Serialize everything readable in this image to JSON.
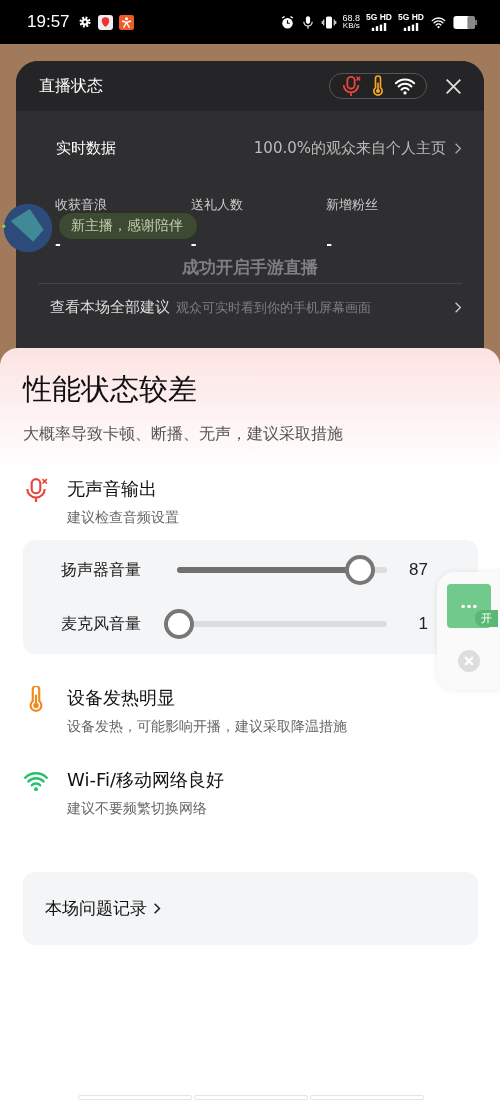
{
  "status_bar": {
    "time": "19:57",
    "speed": "68.8",
    "speed_unit": "KB/s",
    "networks": [
      "5G HD",
      "5G HD"
    ]
  },
  "live_panel": {
    "title": "直播状态",
    "realtime": {
      "label": "实时数据",
      "summary": "100.0%的观众来自个人主页"
    },
    "stats": [
      {
        "label": "收获音浪",
        "value": "-"
      },
      {
        "label": "送礼人数",
        "value": "-"
      },
      {
        "label": "新增粉丝",
        "value": "-"
      }
    ],
    "toast": {
      "title": "成功开启手游直播",
      "message": "观众可实时看到你的手机屏幕画面"
    },
    "suggestions_link": "查看本场全部建议"
  },
  "badge": {
    "text": "新主播，感谢陪伴"
  },
  "sheet": {
    "title": "性能状态较差",
    "subtitle": "大概率导致卡顿、断播、无声，建议采取措施",
    "issues": [
      {
        "kind": "mic",
        "title": "无声音输出",
        "description": "建议检查音频设置"
      },
      {
        "kind": "sliders"
      },
      {
        "kind": "heat",
        "title": "设备发热明显",
        "description": "设备发热，可能影响开播，建议采取降温措施"
      },
      {
        "kind": "wifi",
        "title": "Wi-Fi/移动网络良好",
        "description": "建议不要频繁切换网络"
      }
    ],
    "sliders": [
      {
        "label": "扬声器音量",
        "level": 0.87,
        "reading": "87"
      },
      {
        "label": "麦克风音量",
        "level": 0.01,
        "reading": "1"
      }
    ],
    "record_link": "本场问题记录"
  },
  "floating_widget": {
    "badge": "开"
  }
}
